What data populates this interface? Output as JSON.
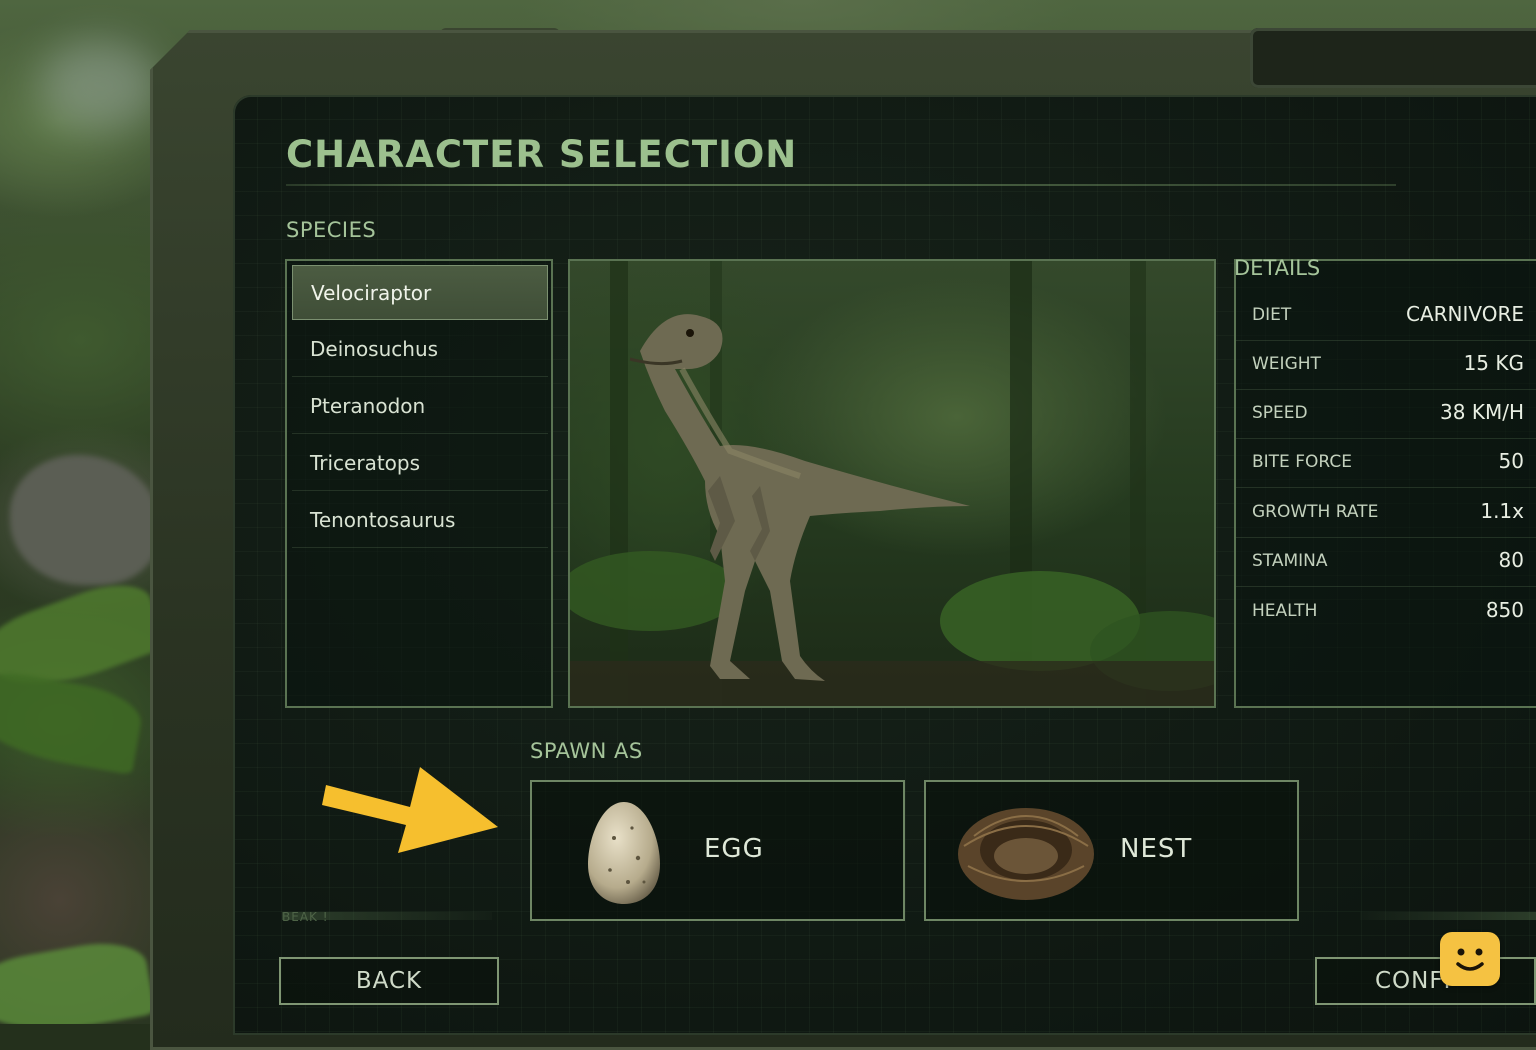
{
  "title": "CHARACTER SELECTION",
  "species_section": {
    "label": "SPECIES",
    "items": [
      {
        "label": "Velociraptor",
        "selected": true
      },
      {
        "label": "Deinosuchus",
        "selected": false
      },
      {
        "label": "Pteranodon",
        "selected": false
      },
      {
        "label": "Triceratops",
        "selected": false
      },
      {
        "label": "Tenontosaurus",
        "selected": false
      }
    ]
  },
  "details": {
    "title": "DETAILS",
    "stats": [
      {
        "label": "DIET",
        "value": "CARNIVORE"
      },
      {
        "label": "WEIGHT",
        "value": "15 KG"
      },
      {
        "label": "SPEED",
        "value": "38 KM/H"
      },
      {
        "label": "BITE FORCE",
        "value": "50"
      },
      {
        "label": "GROWTH RATE",
        "value": "1.1x"
      },
      {
        "label": "STAMINA",
        "value": "80"
      },
      {
        "label": "HEALTH",
        "value": "850"
      }
    ]
  },
  "spawn": {
    "label": "SPAWN AS",
    "options": [
      {
        "label": "EGG",
        "icon": "egg-icon"
      },
      {
        "label": "NEST",
        "icon": "nest-icon"
      }
    ]
  },
  "footer_hint": "BEAK !",
  "buttons": {
    "back": "BACK",
    "confirm": "CONFI"
  },
  "colors": {
    "accent": "#9cc08e",
    "arrow": "#f6bf2e",
    "badge": "#f5c242",
    "panel_border": "#5a7352"
  }
}
